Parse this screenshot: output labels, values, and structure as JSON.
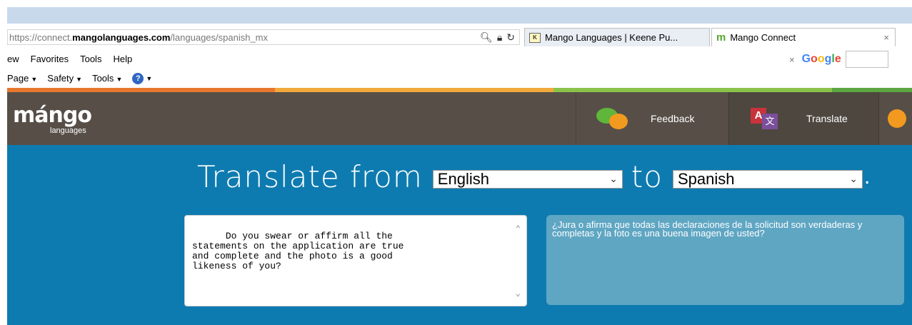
{
  "browser": {
    "address": {
      "scheme": "https://connect.",
      "domain": "mangolanguages.com",
      "path": "/languages/spanish_mx"
    },
    "address_icons": [
      "search-icon",
      "lock-icon",
      "refresh-icon"
    ],
    "tabs": [
      {
        "label": "Mango Languages | Keene Pu...",
        "favicon": "K"
      },
      {
        "label": "Mango Connect",
        "favicon": "m",
        "close": "×"
      }
    ],
    "menu": [
      "ew",
      "Favorites",
      "Tools",
      "Help"
    ],
    "search": {
      "close": "×",
      "engine": "Google"
    },
    "command_bar": [
      "Page",
      "Safety",
      "Tools"
    ]
  },
  "site": {
    "logo": "mángo",
    "logo_sub": "languages",
    "nav": [
      {
        "label": "Feedback",
        "icon": "feedback-bubbles-icon"
      },
      {
        "label": "Translate",
        "icon": "translate-icon"
      }
    ],
    "stripe_colors": [
      "#e8772e",
      "#f2a93b",
      "#8bc34a",
      "#5ca641"
    ]
  },
  "translate": {
    "heading_from": "Translate from",
    "heading_to": "to",
    "period": ".",
    "from_language": "English",
    "to_language": "Spanish",
    "source_text": "Do you swear or affirm all the\nstatements on the application are true\nand complete and the photo is a good\nlikeness of you?",
    "output_text": "¿Jura o afirma que todas las declaraciones de la solicitud son verdaderas y completas y la foto es una buena imagen de usted?"
  }
}
